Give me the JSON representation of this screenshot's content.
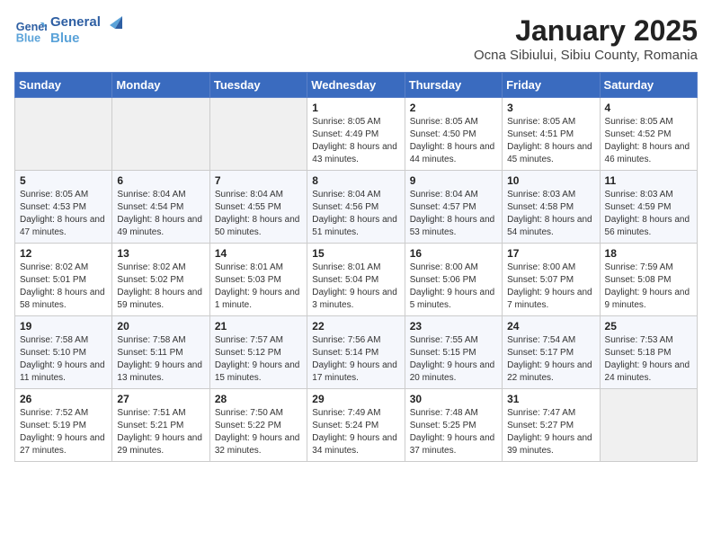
{
  "header": {
    "logo_line1": "General",
    "logo_line2": "Blue",
    "month": "January 2025",
    "location": "Ocna Sibiului, Sibiu County, Romania"
  },
  "weekdays": [
    "Sunday",
    "Monday",
    "Tuesday",
    "Wednesday",
    "Thursday",
    "Friday",
    "Saturday"
  ],
  "weeks": [
    [
      {
        "day": "",
        "info": ""
      },
      {
        "day": "",
        "info": ""
      },
      {
        "day": "",
        "info": ""
      },
      {
        "day": "1",
        "info": "Sunrise: 8:05 AM\nSunset: 4:49 PM\nDaylight: 8 hours and 43 minutes."
      },
      {
        "day": "2",
        "info": "Sunrise: 8:05 AM\nSunset: 4:50 PM\nDaylight: 8 hours and 44 minutes."
      },
      {
        "day": "3",
        "info": "Sunrise: 8:05 AM\nSunset: 4:51 PM\nDaylight: 8 hours and 45 minutes."
      },
      {
        "day": "4",
        "info": "Sunrise: 8:05 AM\nSunset: 4:52 PM\nDaylight: 8 hours and 46 minutes."
      }
    ],
    [
      {
        "day": "5",
        "info": "Sunrise: 8:05 AM\nSunset: 4:53 PM\nDaylight: 8 hours and 47 minutes."
      },
      {
        "day": "6",
        "info": "Sunrise: 8:04 AM\nSunset: 4:54 PM\nDaylight: 8 hours and 49 minutes."
      },
      {
        "day": "7",
        "info": "Sunrise: 8:04 AM\nSunset: 4:55 PM\nDaylight: 8 hours and 50 minutes."
      },
      {
        "day": "8",
        "info": "Sunrise: 8:04 AM\nSunset: 4:56 PM\nDaylight: 8 hours and 51 minutes."
      },
      {
        "day": "9",
        "info": "Sunrise: 8:04 AM\nSunset: 4:57 PM\nDaylight: 8 hours and 53 minutes."
      },
      {
        "day": "10",
        "info": "Sunrise: 8:03 AM\nSunset: 4:58 PM\nDaylight: 8 hours and 54 minutes."
      },
      {
        "day": "11",
        "info": "Sunrise: 8:03 AM\nSunset: 4:59 PM\nDaylight: 8 hours and 56 minutes."
      }
    ],
    [
      {
        "day": "12",
        "info": "Sunrise: 8:02 AM\nSunset: 5:01 PM\nDaylight: 8 hours and 58 minutes."
      },
      {
        "day": "13",
        "info": "Sunrise: 8:02 AM\nSunset: 5:02 PM\nDaylight: 8 hours and 59 minutes."
      },
      {
        "day": "14",
        "info": "Sunrise: 8:01 AM\nSunset: 5:03 PM\nDaylight: 9 hours and 1 minute."
      },
      {
        "day": "15",
        "info": "Sunrise: 8:01 AM\nSunset: 5:04 PM\nDaylight: 9 hours and 3 minutes."
      },
      {
        "day": "16",
        "info": "Sunrise: 8:00 AM\nSunset: 5:06 PM\nDaylight: 9 hours and 5 minutes."
      },
      {
        "day": "17",
        "info": "Sunrise: 8:00 AM\nSunset: 5:07 PM\nDaylight: 9 hours and 7 minutes."
      },
      {
        "day": "18",
        "info": "Sunrise: 7:59 AM\nSunset: 5:08 PM\nDaylight: 9 hours and 9 minutes."
      }
    ],
    [
      {
        "day": "19",
        "info": "Sunrise: 7:58 AM\nSunset: 5:10 PM\nDaylight: 9 hours and 11 minutes."
      },
      {
        "day": "20",
        "info": "Sunrise: 7:58 AM\nSunset: 5:11 PM\nDaylight: 9 hours and 13 minutes."
      },
      {
        "day": "21",
        "info": "Sunrise: 7:57 AM\nSunset: 5:12 PM\nDaylight: 9 hours and 15 minutes."
      },
      {
        "day": "22",
        "info": "Sunrise: 7:56 AM\nSunset: 5:14 PM\nDaylight: 9 hours and 17 minutes."
      },
      {
        "day": "23",
        "info": "Sunrise: 7:55 AM\nSunset: 5:15 PM\nDaylight: 9 hours and 20 minutes."
      },
      {
        "day": "24",
        "info": "Sunrise: 7:54 AM\nSunset: 5:17 PM\nDaylight: 9 hours and 22 minutes."
      },
      {
        "day": "25",
        "info": "Sunrise: 7:53 AM\nSunset: 5:18 PM\nDaylight: 9 hours and 24 minutes."
      }
    ],
    [
      {
        "day": "26",
        "info": "Sunrise: 7:52 AM\nSunset: 5:19 PM\nDaylight: 9 hours and 27 minutes."
      },
      {
        "day": "27",
        "info": "Sunrise: 7:51 AM\nSunset: 5:21 PM\nDaylight: 9 hours and 29 minutes."
      },
      {
        "day": "28",
        "info": "Sunrise: 7:50 AM\nSunset: 5:22 PM\nDaylight: 9 hours and 32 minutes."
      },
      {
        "day": "29",
        "info": "Sunrise: 7:49 AM\nSunset: 5:24 PM\nDaylight: 9 hours and 34 minutes."
      },
      {
        "day": "30",
        "info": "Sunrise: 7:48 AM\nSunset: 5:25 PM\nDaylight: 9 hours and 37 minutes."
      },
      {
        "day": "31",
        "info": "Sunrise: 7:47 AM\nSunset: 5:27 PM\nDaylight: 9 hours and 39 minutes."
      },
      {
        "day": "",
        "info": ""
      }
    ]
  ]
}
